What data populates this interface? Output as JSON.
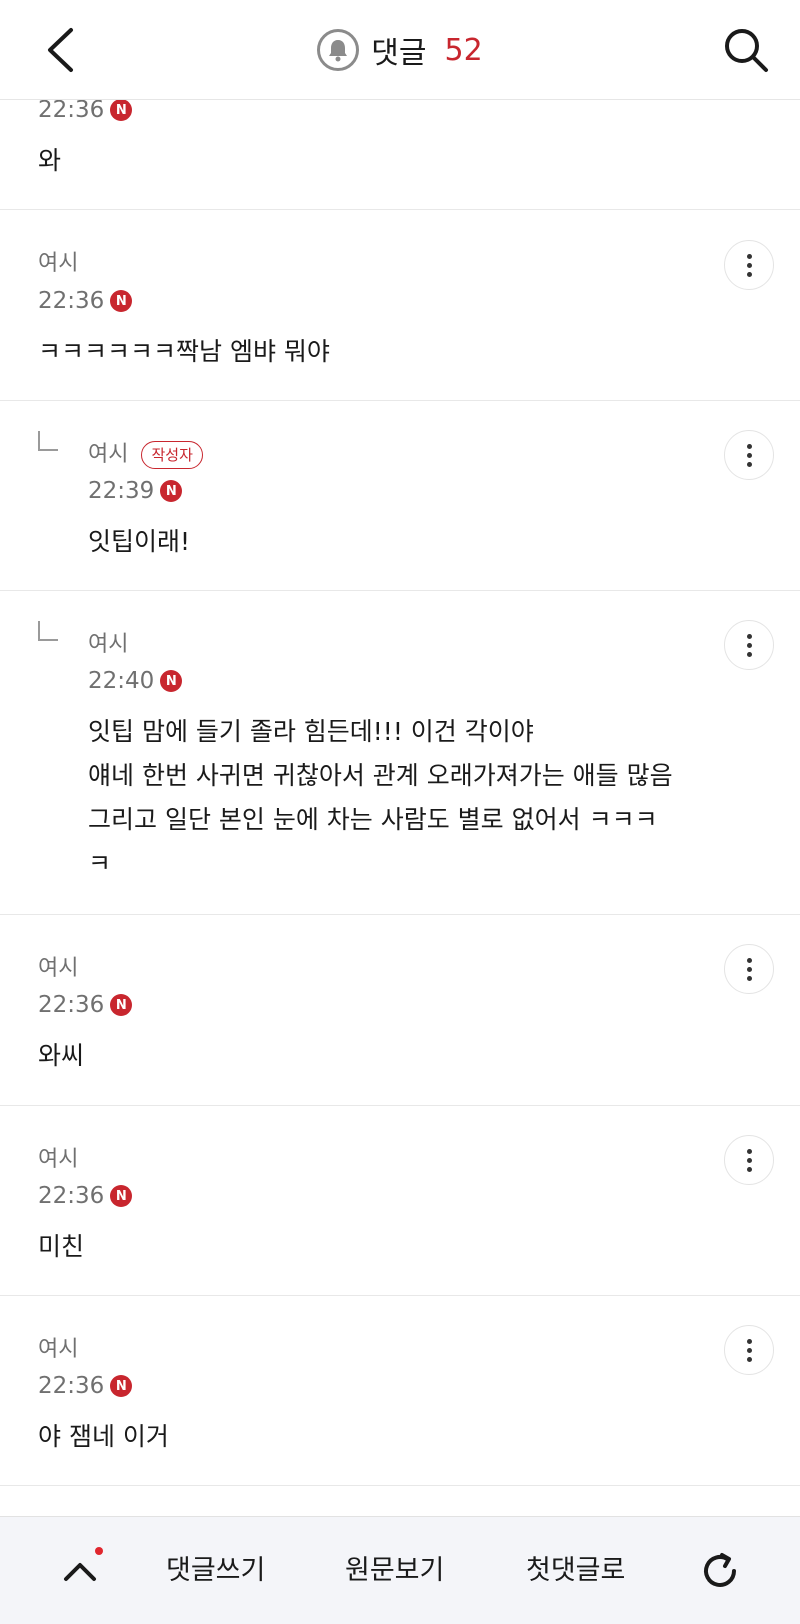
{
  "header": {
    "title": "댓글",
    "count": "52"
  },
  "comments": [
    {
      "author": "",
      "time": "22:36",
      "body": "와",
      "badge": "N"
    },
    {
      "author": "여시",
      "time": "22:36",
      "body": "ㅋㅋㅋㅋㅋㅋ짝남 엠뱌 뭐야",
      "badge": "N"
    },
    {
      "author": "여시",
      "writer_tag": "작성자",
      "time": "22:39",
      "body": "잇팁이래!",
      "badge": "N",
      "reply": true
    },
    {
      "author": "여시",
      "time": "22:40",
      "body": "잇팁 맘에 들기 졸라 힘든데!!! 이건 각이야\n얘네 한번 사귀면 귀찮아서 관계 오래가져가는 애들 많음\n그리고 일단 본인 눈에 차는 사람도 별로 없어서 ㅋㅋㅋ\nㅋ",
      "badge": "N",
      "reply": true
    },
    {
      "author": "여시",
      "time": "22:36",
      "body": "와씨",
      "badge": "N"
    },
    {
      "author": "여시",
      "time": "22:36",
      "body": "미친",
      "badge": "N"
    },
    {
      "author": "여시",
      "time": "22:36",
      "body": "야 잼네 이거",
      "badge": "N"
    }
  ],
  "bottom_bar": {
    "write_comment": "댓글쓰기",
    "view_original": "원문보기",
    "first_comment": "첫댓글로"
  },
  "colors": {
    "accent": "#c8262e",
    "meta_text": "#707070",
    "bottom_bar_bg": "#f4f5f9"
  },
  "icons": [
    "back-arrow-icon",
    "bell-icon",
    "search-icon",
    "more-vert-icon",
    "chevron-up-icon",
    "refresh-icon"
  ]
}
